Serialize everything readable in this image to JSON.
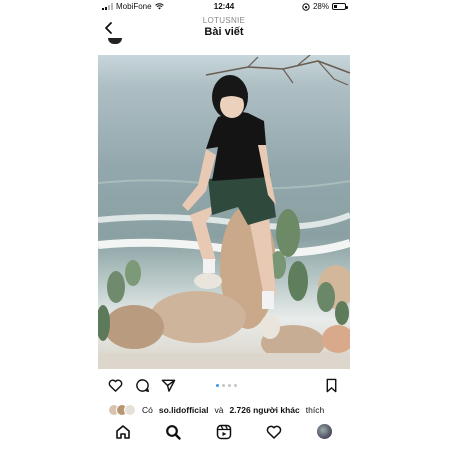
{
  "status_bar": {
    "carrier": "MobiFone",
    "time": "12:44",
    "battery": "28%",
    "battery_level": 0.28
  },
  "header": {
    "username": "LOTUSNIE",
    "title": "Bài viết"
  },
  "post": {
    "image_icon": "photo",
    "carousel_dots": 4,
    "carousel_active_index": 0
  },
  "likes": {
    "prefix": "Có",
    "user": "so.lidofficial",
    "and_text": "và",
    "count": "2.726 người khác",
    "suffix": "thích"
  },
  "colors": {
    "accent": "#3797f0",
    "text": "#111111",
    "muted": "#888888"
  },
  "nav": {
    "items": [
      "home-icon",
      "search-icon",
      "reels-icon",
      "heart-icon",
      "profile-avatar"
    ]
  }
}
